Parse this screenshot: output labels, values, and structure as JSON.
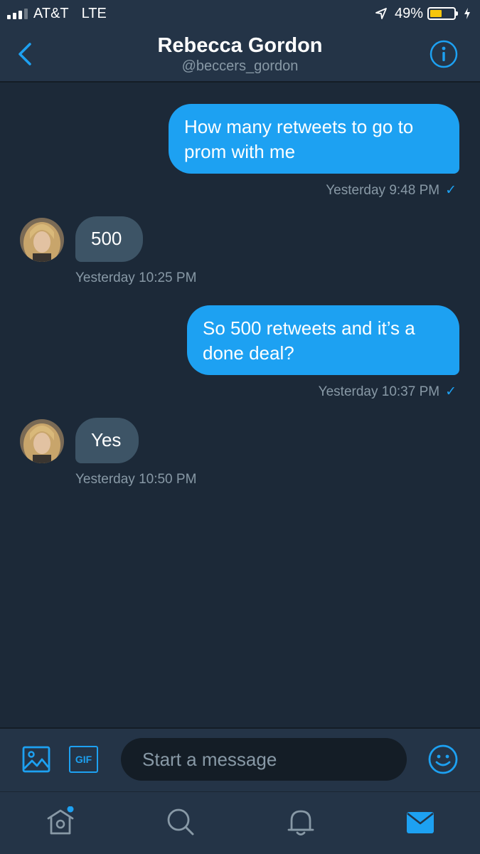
{
  "status_bar": {
    "carrier": "AT&T",
    "network": "LTE",
    "battery_percent": "49%",
    "battery_level": 0.49,
    "battery_color": "#f5c60a"
  },
  "header": {
    "title": "Rebecca Gordon",
    "handle": "@beccers_gordon",
    "back_icon": "chevron-left-icon",
    "info_icon": "info-icon"
  },
  "messages": [
    {
      "direction": "sent",
      "text": "How many retweets to go to prom with me",
      "time": "Yesterday 9:48 PM",
      "read": "✓"
    },
    {
      "direction": "received",
      "text": "500",
      "time": "Yesterday 10:25 PM"
    },
    {
      "direction": "sent",
      "text": "So 500 retweets and it’s a done deal?",
      "time": "Yesterday 10:37 PM",
      "read": "✓"
    },
    {
      "direction": "received",
      "text": "Yes",
      "time": "Yesterday 10:50 PM"
    }
  ],
  "composer": {
    "placeholder": "Start a message",
    "gif_label": "GIF",
    "image_icon": "image-icon",
    "emoji_icon": "emoji-icon"
  },
  "tabbar": {
    "items": [
      "home-icon",
      "search-icon",
      "notifications-icon",
      "messages-icon"
    ],
    "active": "messages-icon"
  },
  "colors": {
    "accent": "#1da1f2",
    "background": "#1c2938",
    "header": "#243447",
    "received_bubble": "#3d5466",
    "muted_text": "#8899a6"
  }
}
